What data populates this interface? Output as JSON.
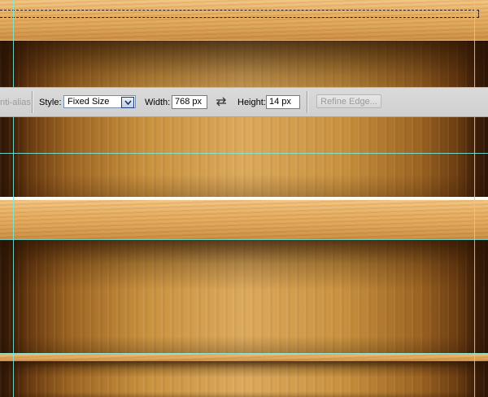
{
  "options_bar": {
    "anti_alias_label": "nti-alias",
    "style_label": "Style:",
    "style_value": "Fixed Size",
    "width_label": "Width:",
    "width_value": "768 px",
    "height_label": "Height:",
    "height_value": "14 px",
    "refine_edge_label": "Refine Edge...",
    "icons": [
      "chevron-down-icon",
      "swap-arrows-icon"
    ]
  },
  "colors": {
    "guide": "#78ebe1",
    "shelf_light": "#f1c27e",
    "shelf_dark": "#c98a3c",
    "wall_dark": "#2e1604",
    "wall_light": "#dcaa5c"
  }
}
